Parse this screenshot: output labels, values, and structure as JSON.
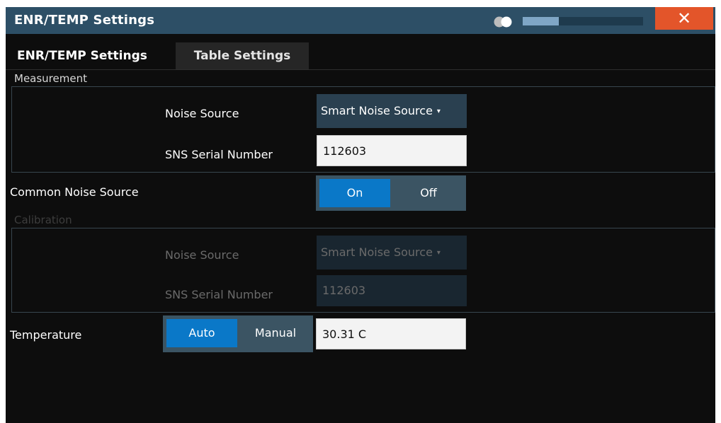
{
  "window": {
    "title": "ENR/TEMP Settings",
    "close_symbol": "✕",
    "progress_fraction": 0.3
  },
  "tabs": [
    {
      "label": "ENR/TEMP Settings",
      "active": true
    },
    {
      "label": "Table Settings",
      "active": false
    }
  ],
  "measurement": {
    "section_label": "Measurement",
    "noise_source_label": "Noise Source",
    "noise_source_value": "Smart Noise Source",
    "sns_serial_label": "SNS Serial Number",
    "sns_serial_value": "112603"
  },
  "common_noise_source": {
    "label": "Common Noise Source",
    "options": [
      "On",
      "Off"
    ],
    "selected": "On"
  },
  "calibration": {
    "section_label": "Calibration",
    "noise_source_label": "Noise Source",
    "noise_source_value": "Smart Noise Source",
    "sns_serial_label": "SNS Serial Number",
    "sns_serial_value": "112603",
    "disabled": true
  },
  "temperature": {
    "label": "Temperature",
    "options": [
      "Auto",
      "Manual"
    ],
    "selected": "Auto",
    "value": "30.31 C"
  },
  "colors": {
    "titlebar": "#2d4f66",
    "accent": "#0a78c8",
    "close": "#e3552a"
  },
  "icons": {
    "dropdown_arrow": "▾"
  }
}
